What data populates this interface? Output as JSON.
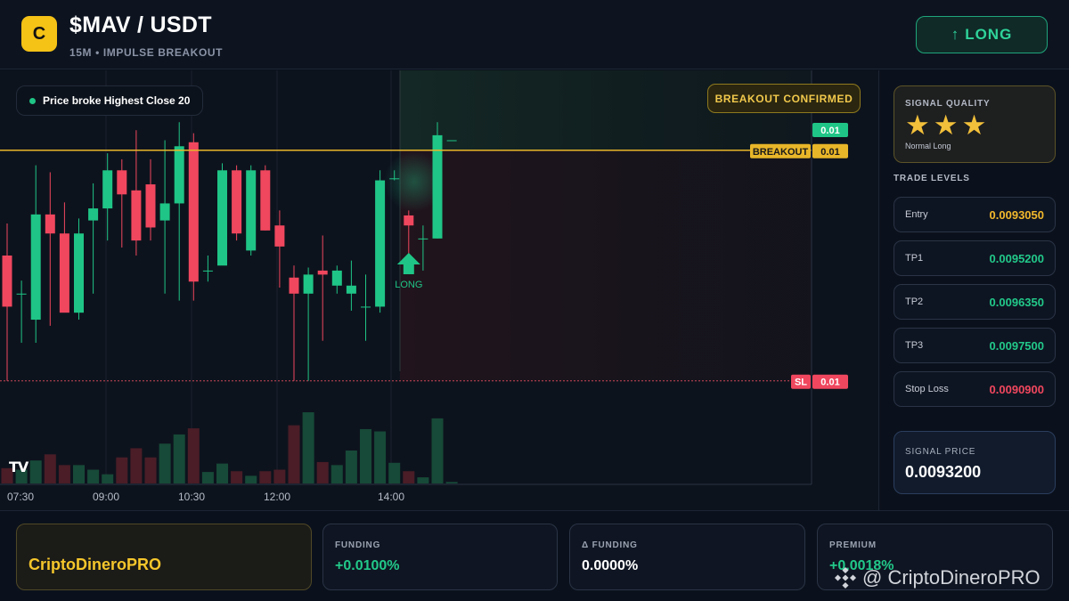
{
  "header": {
    "logo_letter": "C",
    "pair": "$MAV / USDT",
    "subtitle": "15M • IMPULSE BREAKOUT",
    "long_button": {
      "arrow": "↑",
      "label": "LONG"
    }
  },
  "chart": {
    "indicator_pill": "Price broke Highest Close 20",
    "badge": "BREAKOUT CONFIRMED",
    "signal_marker_label": "LONG",
    "tv_logo": "TV",
    "price_tags": {
      "last": "0.01",
      "breakout_label": "BREAKOUT",
      "breakout_value": "0.01",
      "sl_label": "SL",
      "sl_value": "0.01"
    },
    "x_ticks": [
      "07:30",
      "09:00",
      "10:30",
      "12:00",
      "14:00"
    ]
  },
  "chart_data": {
    "type": "candlestick",
    "timeframe": "15M",
    "price_lines": {
      "breakout": 0.00932,
      "stop_loss": 0.00909
    },
    "candles": [
      {
        "o": 0.009215,
        "h": 0.009247,
        "l": 0.00909,
        "c": 0.009164,
        "v": 0.2
      },
      {
        "o": 0.009177,
        "h": 0.00919,
        "l": 0.009128,
        "c": 0.009177,
        "v": 0.18
      },
      {
        "o": 0.009151,
        "h": 0.009305,
        "l": 0.009128,
        "c": 0.009256,
        "v": 0.3
      },
      {
        "o": 0.009256,
        "h": 0.009298,
        "l": 0.009145,
        "c": 0.009237,
        "v": 0.38
      },
      {
        "o": 0.009237,
        "h": 0.009268,
        "l": 0.00919,
        "c": 0.009158,
        "v": 0.24
      },
      {
        "o": 0.009158,
        "h": 0.009252,
        "l": 0.009151,
        "c": 0.009237,
        "v": 0.24
      },
      {
        "o": 0.00925,
        "h": 0.009287,
        "l": 0.009177,
        "c": 0.009262,
        "v": 0.18
      },
      {
        "o": 0.009262,
        "h": 0.009317,
        "l": 0.00923,
        "c": 0.0093,
        "v": 0.12
      },
      {
        "o": 0.0093,
        "h": 0.009311,
        "l": 0.009223,
        "c": 0.009276,
        "v": 0.34
      },
      {
        "o": 0.00928,
        "h": 0.00934,
        "l": 0.009215,
        "c": 0.00923,
        "v": 0.46
      },
      {
        "o": 0.009286,
        "h": 0.009311,
        "l": 0.00923,
        "c": 0.009243,
        "v": 0.34
      },
      {
        "o": 0.00925,
        "h": 0.00933,
        "l": 0.009177,
        "c": 0.009267,
        "v": 0.52
      },
      {
        "o": 0.009267,
        "h": 0.009348,
        "l": 0.00917,
        "c": 0.009324,
        "v": 0.64
      },
      {
        "o": 0.009328,
        "h": 0.009337,
        "l": 0.00917,
        "c": 0.009189,
        "v": 0.72
      },
      {
        "o": 0.0092,
        "h": 0.009215,
        "l": 0.009189,
        "c": 0.0092,
        "v": 0.15
      },
      {
        "o": 0.009205,
        "h": 0.009307,
        "l": 0.00921,
        "c": 0.0093,
        "v": 0.26
      },
      {
        "o": 0.0093,
        "h": 0.009305,
        "l": 0.00923,
        "c": 0.009237,
        "v": 0.16
      },
      {
        "o": 0.00922,
        "h": 0.009305,
        "l": 0.009215,
        "c": 0.0093,
        "v": 0.1
      },
      {
        "o": 0.0093,
        "h": 0.009305,
        "l": 0.00924,
        "c": 0.00924,
        "v": 0.16
      },
      {
        "o": 0.009245,
        "h": 0.00926,
        "l": 0.009183,
        "c": 0.009224,
        "v": 0.18
      },
      {
        "o": 0.009193,
        "h": 0.009205,
        "l": 0.00909,
        "c": 0.009177,
        "v": 0.76
      },
      {
        "o": 0.009177,
        "h": 0.009203,
        "l": 0.00909,
        "c": 0.009196,
        "v": 0.93
      },
      {
        "o": 0.0092,
        "h": 0.009235,
        "l": 0.00913,
        "c": 0.009196,
        "v": 0.28
      },
      {
        "o": 0.009185,
        "h": 0.009205,
        "l": 0.009177,
        "c": 0.0092,
        "v": 0.24
      },
      {
        "o": 0.009177,
        "h": 0.00921,
        "l": 0.00916,
        "c": 0.009185,
        "v": 0.43
      },
      {
        "o": 0.009164,
        "h": 0.009196,
        "l": 0.00913,
        "c": 0.009164,
        "v": 0.71
      },
      {
        "o": 0.009164,
        "h": 0.0093,
        "l": 0.009158,
        "c": 0.00929,
        "v": 0.68
      },
      {
        "o": 0.009292,
        "h": 0.0093,
        "l": 0.00929,
        "c": 0.009292,
        "v": 0.27
      },
      {
        "o": 0.009255,
        "h": 0.00926,
        "l": 0.00921,
        "c": 0.009245,
        "v": 0.16
      },
      {
        "o": 0.009232,
        "h": 0.009245,
        "l": 0.0092,
        "c": 0.009232,
        "v": 0.08
      },
      {
        "o": 0.009232,
        "h": 0.009348,
        "l": 0.009232,
        "c": 0.009335,
        "v": 0.85
      },
      {
        "o": 0.00933,
        "h": 0.00933,
        "l": 0.00933,
        "c": 0.00933,
        "v": 0.02
      }
    ]
  },
  "sidebar": {
    "signal_quality": {
      "title": "SIGNAL QUALITY",
      "stars": 3,
      "star_glyph": "★",
      "subtitle": "Normal Long"
    },
    "trade_levels_title": "TRADE LEVELS",
    "levels": [
      {
        "label": "Entry",
        "value": "0.0093050",
        "color": "#f2b92c"
      },
      {
        "label": "TP1",
        "value": "0.0095200",
        "color": "#22c98a"
      },
      {
        "label": "TP2",
        "value": "0.0096350",
        "color": "#22c98a"
      },
      {
        "label": "TP3",
        "value": "0.0097500",
        "color": "#22c98a"
      },
      {
        "label": "Stop Loss",
        "value": "0.0090900",
        "color": "#f0475e"
      }
    ],
    "signal_price": {
      "title": "SIGNAL PRICE",
      "value": "0.0093200"
    }
  },
  "footer": {
    "brand": "CriptoDineroPRO",
    "stats": [
      {
        "title": "FUNDING",
        "value": "+0.0100%",
        "color": "#22c98a"
      },
      {
        "title": "Δ FUNDING",
        "value": "0.0000%",
        "color": "#ffffff"
      },
      {
        "title": "PREMIUM",
        "value": "+0.0018%",
        "color": "#22c98a"
      }
    ],
    "watermark": "@ CriptoDineroPRO"
  },
  "colors": {
    "up": "#1fc586",
    "down": "#f0475e",
    "breakout_line": "#e8b629",
    "accent_gold": "#f5c216"
  }
}
